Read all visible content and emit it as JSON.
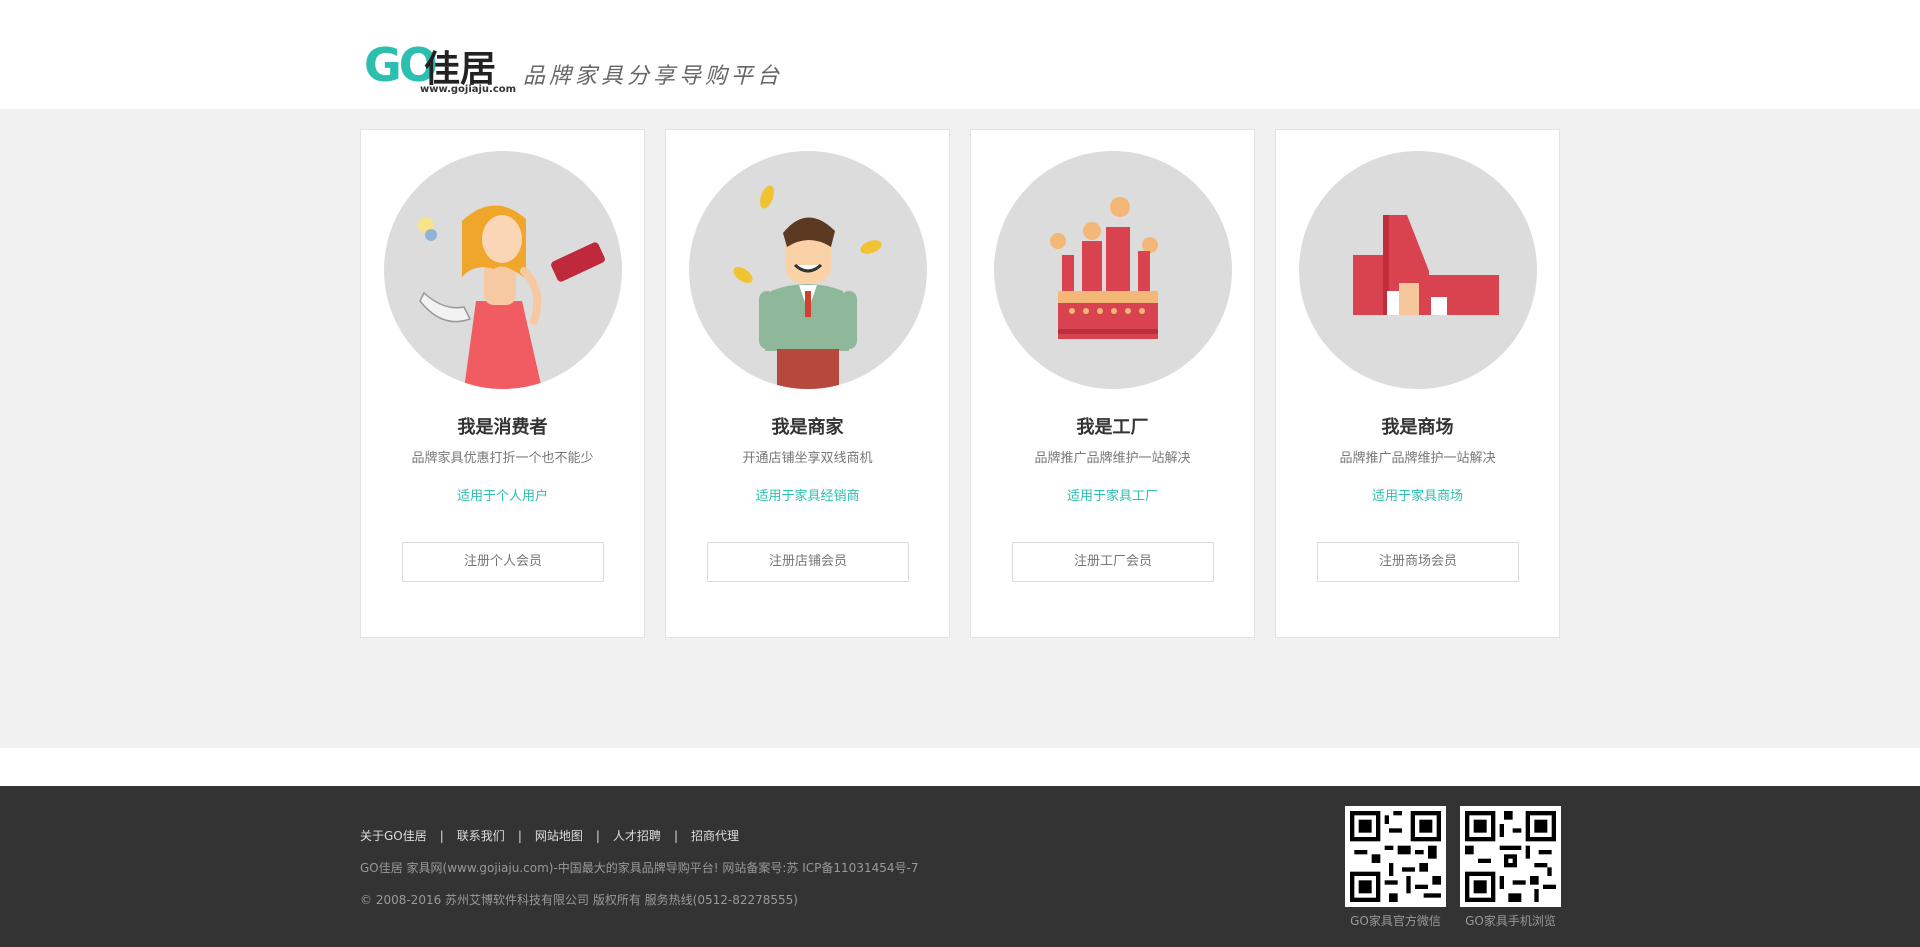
{
  "header": {
    "logo_go": "GO",
    "logo_cn": "佳居",
    "logo_url": "www.gojiaju.com",
    "slogan": "品牌家具分享导购平台"
  },
  "cards": [
    {
      "title": "我是消费者",
      "desc": "品牌家具优惠打折一个也不能少",
      "tag": "适用于个人用户",
      "button": "注册个人会员"
    },
    {
      "title": "我是商家",
      "desc": "开通店铺坐享双线商机",
      "tag": "适用于家具经销商",
      "button": "注册店铺会员"
    },
    {
      "title": "我是工厂",
      "desc": "品牌推广品牌维护一站解决",
      "tag": "适用于家具工厂",
      "button": "注册工厂会员"
    },
    {
      "title": "我是商场",
      "desc": "品牌推广品牌维护一站解决",
      "tag": "适用于家具商场",
      "button": "注册商场会员"
    }
  ],
  "footer": {
    "links": [
      "关于GO佳居",
      "联系我们",
      "网站地图",
      "人才招聘",
      "招商代理"
    ],
    "separator": "|",
    "line1": "GO佳居 家具网(www.gojiaju.com)-中国最大的家具品牌导购平台! 网站备案号:苏 ICP备11031454号-7",
    "line2": "© 2008-2016 苏州艾博软件科技有限公司 版权所有 服务热线(0512-82278555)",
    "qr": [
      {
        "label": "GO家具官方微信"
      },
      {
        "label": "GO家具手机浏览"
      }
    ]
  },
  "colors": {
    "accent": "#2cbfb0",
    "footer_bg": "#333333",
    "main_bg": "#f1f1f1"
  }
}
